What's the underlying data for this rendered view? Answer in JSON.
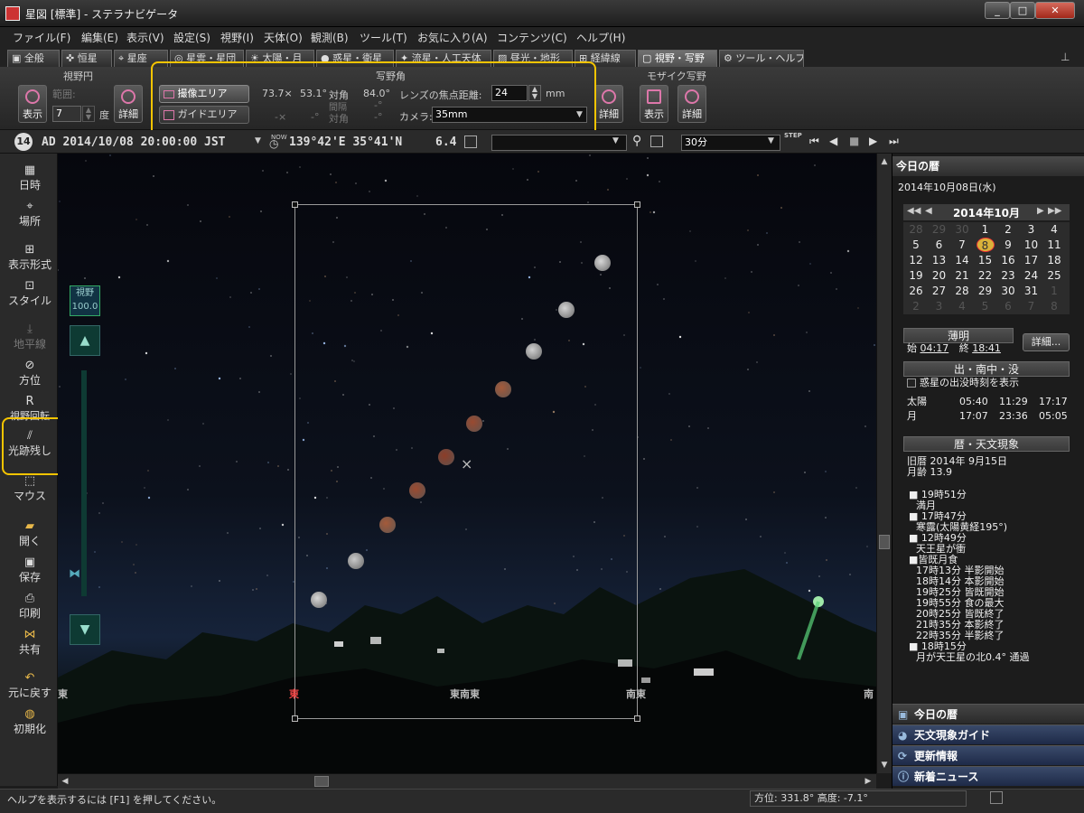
{
  "window": {
    "title": "星図 [標準] - ステラナビゲータ",
    "min": "_",
    "max": "□",
    "close": "✕"
  },
  "menu": [
    "ファイル(F)",
    "編集(E)",
    "表示(V)",
    "設定(S)",
    "視野(I)",
    "天体(O)",
    "観測(B)",
    "ツール(T)",
    "お気に入り(A)",
    "コンテンツ(C)",
    "ヘルプ(H)"
  ],
  "tabs": [
    "全般",
    "恒星",
    "星座",
    "星雲・星団",
    "太陽・月",
    "惑星・衛星",
    "流星・人工天体",
    "昼光・地形",
    "経緯線",
    "視野・写野",
    "ツール・ヘルプ"
  ],
  "ribbon": {
    "fov_circle": {
      "title": "視野円",
      "show": "表示",
      "range_label": "範囲:",
      "range_value": "7",
      "unit": "度",
      "detail": "詳細"
    },
    "photo": {
      "title": "写野角",
      "sensor_area": "撮像エリア",
      "guide_area": "ガイドエリア",
      "w": "73.7×",
      "h": "53.1°",
      "diag_label": "対角",
      "diag_value": "84.0°",
      "dash1": "-×",
      "dash2": "-°",
      "interval_label": "間隔",
      "dash3": "-°",
      "diag2_label": "対角",
      "dash4": "-°",
      "focal_label": "レンズの焦点距離:",
      "focal_value": "24",
      "focal_unit": "mm",
      "camera_label": "カメラ:",
      "camera_value": "35mm",
      "detail": "詳細"
    },
    "mosaic": {
      "title": "モザイク写野",
      "show": "表示",
      "detail": "詳細"
    }
  },
  "infobar": {
    "badge": "14",
    "datetime": "AD 2014/10/08 20:00:00 JST",
    "now": "NOW",
    "location": "139°42'E 35°41'N",
    "mag": "6.4",
    "step_value": "30分",
    "step_label": "STEP"
  },
  "left_panel": [
    "日時",
    "場所",
    "表示形式",
    "スタイル",
    "地平線",
    "方位",
    "視野回転",
    "光跡残し",
    "マウス",
    "開く",
    "保存",
    "印刷",
    "共有",
    "元に戻す",
    "初期化"
  ],
  "sky": {
    "fov_label": "視野",
    "fov_value": "100.0",
    "directions": [
      "東",
      "東",
      "東南東",
      "南東",
      "南"
    ],
    "moon_colors": [
      "#d7d7d7",
      "#d2d2d2",
      "#d0d0d0",
      "#a45a3a",
      "#9a4a30",
      "#8d3d28",
      "#9a4a30",
      "#a45a3a",
      "#c9c9c9",
      "#d7d7d7"
    ]
  },
  "right_panel": {
    "title": "今日の暦",
    "date": "2014年10月08日(水)",
    "month": "2014年10月",
    "calendar": [
      [
        "28",
        "29",
        "30",
        "1",
        "2",
        "3",
        "4"
      ],
      [
        "5",
        "6",
        "7",
        "8",
        "9",
        "10",
        "11"
      ],
      [
        "12",
        "13",
        "14",
        "15",
        "16",
        "17",
        "18"
      ],
      [
        "19",
        "20",
        "21",
        "22",
        "23",
        "24",
        "25"
      ],
      [
        "26",
        "27",
        "28",
        "29",
        "30",
        "31",
        "1"
      ],
      [
        "2",
        "3",
        "4",
        "5",
        "6",
        "7",
        "8"
      ]
    ],
    "twilight": {
      "title": "薄明",
      "start_label": "始",
      "start": "04:17",
      "end_label": "終",
      "end": "18:41",
      "detail": "詳細..."
    },
    "rise": {
      "title": "出・南中・没",
      "planet_check": "惑星の出没時刻を表示",
      "rows": [
        [
          "太陽",
          "05:40",
          "11:29",
          "17:17"
        ],
        [
          "月",
          "17:07",
          "23:36",
          "05:05"
        ]
      ]
    },
    "events": {
      "title": "暦・天文現象",
      "lunar": "旧暦 2014年 9月15日",
      "age": "月齢 13.9",
      "lines": [
        "■ 19時51分",
        "満月",
        "■ 17時47分",
        "寒露(太陽黄経195°)",
        "■ 12時49分",
        "天王星が衝",
        "■皆既月食",
        "17時13分 半影開始",
        "18時14分 本影開始",
        "19時25分 皆既開始",
        "19時55分 食の最大",
        "20時25分 皆既終了",
        "21時35分 本影終了",
        "22時35分 半影終了",
        "■ 18時15分",
        "月が天王星の北0.4° 通過"
      ]
    },
    "footer": [
      "今日の暦",
      "天文現象ガイド",
      "更新情報",
      "新着ニュース"
    ]
  },
  "status": {
    "help": "ヘルプを表示するには [F1] を押してください。",
    "coords": "方位: 331.8° 高度: -7.1°"
  },
  "colors": {
    "highlight": "#f5c400",
    "accent": "#d47aa8",
    "footer": "#2a3a66"
  }
}
